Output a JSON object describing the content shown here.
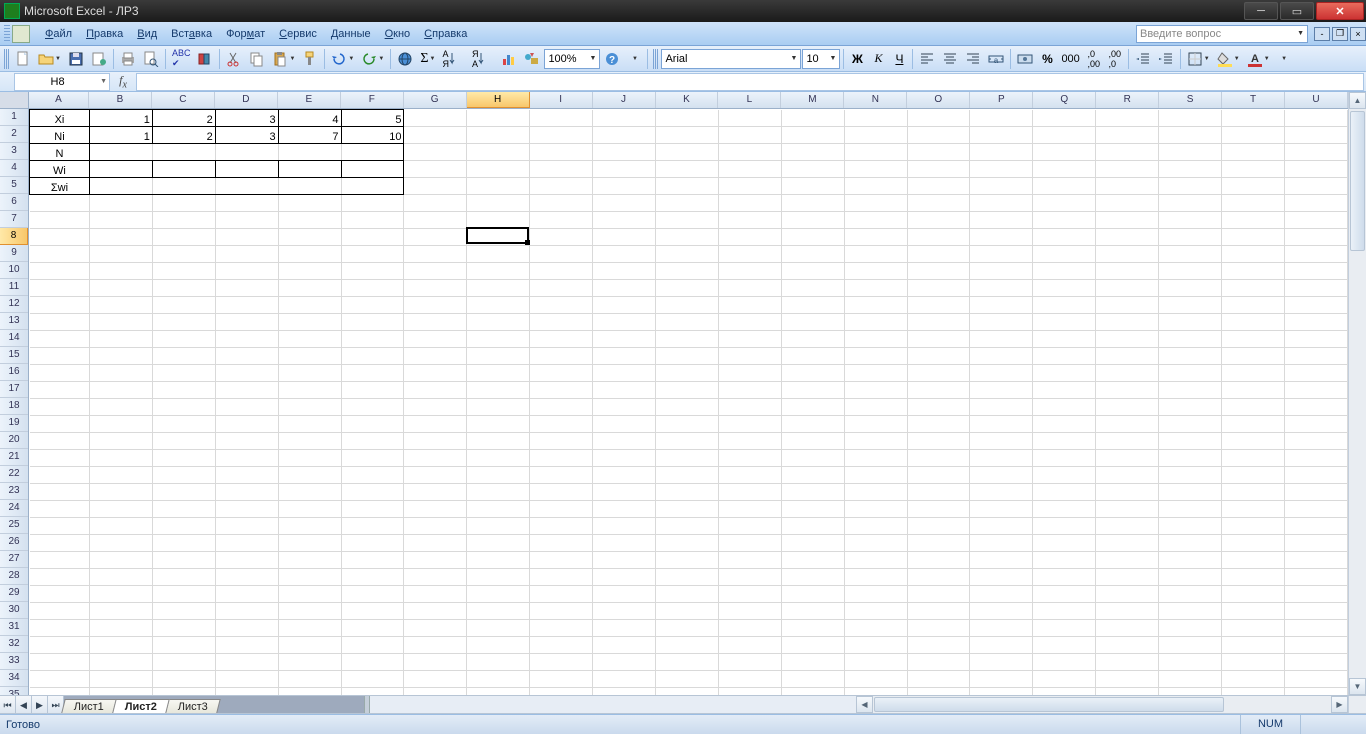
{
  "titlebar": {
    "appname": "Microsoft Excel",
    "docname": "ЛР3"
  },
  "menu": {
    "file": "Файл",
    "edit": "Правка",
    "view": "Вид",
    "insert": "Вставка",
    "format": "Формат",
    "tools": "Сервис",
    "data": "Данные",
    "window": "Окно",
    "help": "Справка"
  },
  "qbox_placeholder": "Введите вопрос",
  "toolbar": {
    "zoom": "100%",
    "font": "Arial",
    "size": "10"
  },
  "namebox": "H8",
  "columns": [
    "A",
    "B",
    "C",
    "D",
    "E",
    "F",
    "G",
    "H",
    "I",
    "J",
    "K",
    "L",
    "M",
    "N",
    "O",
    "P",
    "Q",
    "R",
    "S",
    "T",
    "U"
  ],
  "selected_col_index": 7,
  "rows": 35,
  "selected_row": 8,
  "celldata": {
    "labels": {
      "A1": "Xi",
      "A2": "Ni",
      "A3": "N",
      "A4": "Wi",
      "A5": "Σwi"
    },
    "row1": {
      "B": "1",
      "C": "2",
      "D": "3",
      "E": "4",
      "F": "5"
    },
    "row2": {
      "B": "1",
      "C": "2",
      "D": "3",
      "E": "7",
      "F": "10"
    }
  },
  "tabs": {
    "nav": [
      "⏮",
      "◀",
      "▶",
      "⏭"
    ],
    "sheets": [
      "Лист1",
      "Лист2",
      "Лист3"
    ],
    "active": 1
  },
  "status": {
    "ready": "Готово",
    "num": "NUM"
  }
}
